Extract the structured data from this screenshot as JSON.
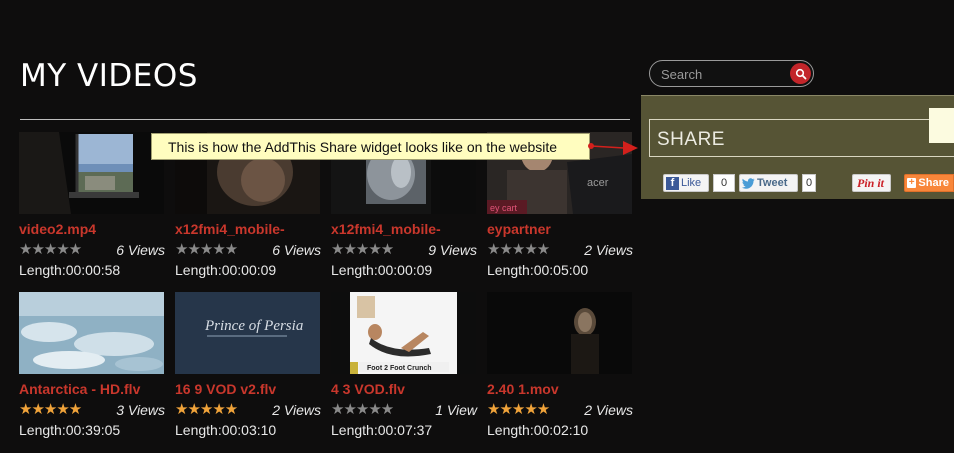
{
  "page": {
    "title": "MY VIDEOS"
  },
  "search": {
    "placeholder": "Search"
  },
  "videos": [
    {
      "title": "video2.mp4",
      "rating": 0,
      "views": "6 Views",
      "length": "Length:00:00:58",
      "thumb": "window"
    },
    {
      "title": "x12fmi4_mobile-",
      "rating": 0,
      "views": "6 Views",
      "length": "Length:00:00:09",
      "thumb": "blur"
    },
    {
      "title": "x12fmi4_mobile-",
      "rating": 0,
      "views": "9 Views",
      "length": "Length:00:00:09",
      "thumb": "blur2"
    },
    {
      "title": "eypartner",
      "rating": 0,
      "views": "2 Views",
      "length": "Length:00:05:00",
      "thumb": "acer"
    },
    {
      "title": "Antarctica - HD.flv",
      "rating": 5,
      "views": "3 Views",
      "length": "Length:00:39:05",
      "thumb": "ice"
    },
    {
      "title": "16 9 VOD v2.flv",
      "rating": 5,
      "views": "2 Views",
      "length": "Length:00:03:10",
      "thumb": "persia"
    },
    {
      "title": "4 3 VOD.flv",
      "rating": 0,
      "views": "1 View",
      "length": "Length:00:07:37",
      "thumb": "crunch"
    },
    {
      "title": "2.40 1.mov",
      "rating": 5,
      "views": "2 Views",
      "length": "Length:00:02:10",
      "thumb": "dark"
    }
  ],
  "thumb_text": {
    "acer": "acer",
    "cart": "ey cart",
    "persia_line1": "Prince of Persia",
    "crunch_caption": "Foot 2 Foot Crunch"
  },
  "share": {
    "label": "SHARE",
    "like_label": "Like",
    "like_count": "0",
    "tweet_label": "Tweet",
    "tweet_count": "0",
    "pinit_label": "Pin it",
    "share_label": "Share"
  },
  "callout": {
    "text": "This is how the AddThis Share widget looks like on the website"
  },
  "colors": {
    "accent": "#c9372c",
    "star_on": "#f0a33a",
    "panel": "#565435",
    "callout_bg": "#fffdbf"
  }
}
